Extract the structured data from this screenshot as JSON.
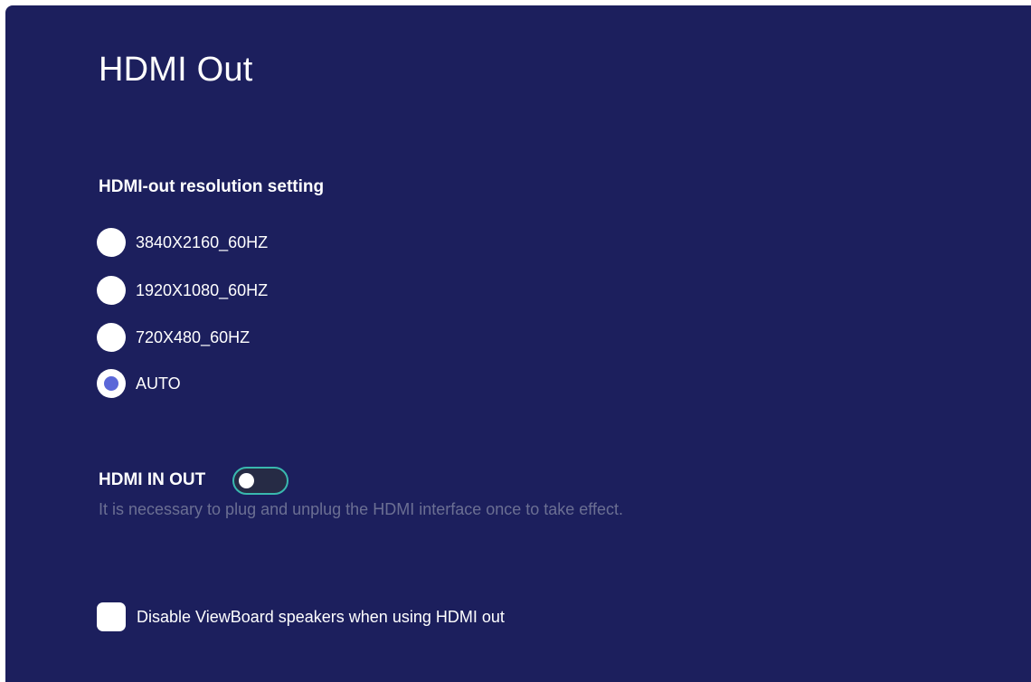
{
  "page": {
    "title": "HDMI Out"
  },
  "resolution": {
    "section_title": "HDMI-out resolution setting",
    "options": [
      {
        "label": "3840X2160_60HZ",
        "selected": false
      },
      {
        "label": "1920X1080_60HZ",
        "selected": false
      },
      {
        "label": "720X480_60HZ",
        "selected": false
      },
      {
        "label": "AUTO",
        "selected": true
      }
    ]
  },
  "hdmi_in_out": {
    "label": "HDMI IN OUT",
    "enabled": false,
    "hint": "It is necessary to plug and unplug the HDMI interface once to take effect."
  },
  "speakers": {
    "label": "Disable ViewBoard speakers when using HDMI out",
    "checked": false
  },
  "colors": {
    "background": "#1c1f5d",
    "accent": "#5a67d8",
    "toggle_border": "#39b8ae",
    "hint_text": "#6b6f93"
  }
}
